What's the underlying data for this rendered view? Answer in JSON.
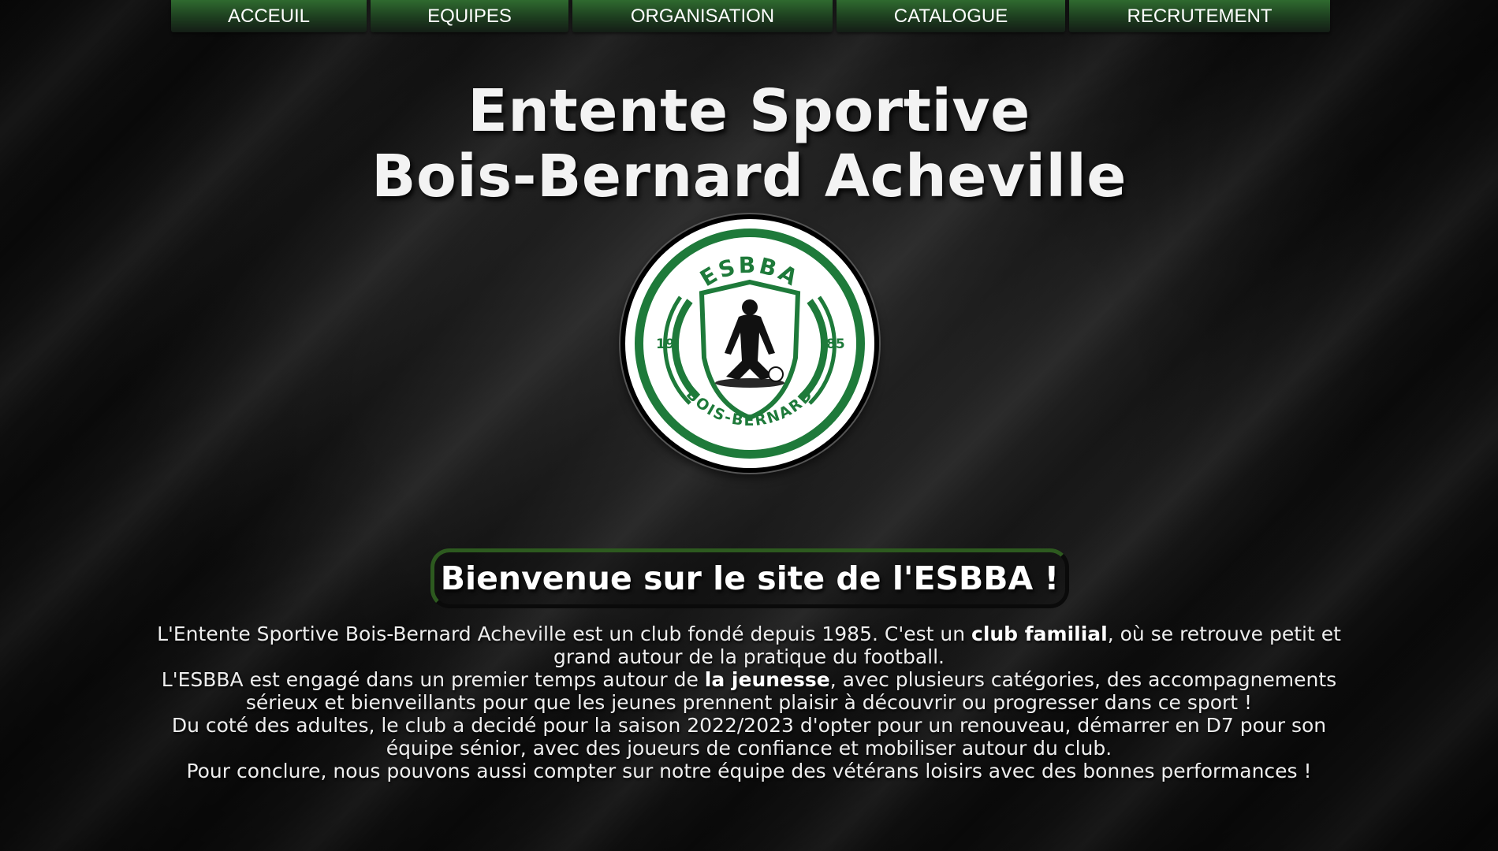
{
  "nav": {
    "items": [
      {
        "label": "ACCEUIL"
      },
      {
        "label": "EQUIPES"
      },
      {
        "label": "ORGANISATION"
      },
      {
        "label": "CATALOGUE"
      },
      {
        "label": "RECRUTEMENT"
      }
    ]
  },
  "hero": {
    "title_line1": "Entente Sportive",
    "title_line2": "Bois-Bernard Acheville"
  },
  "logo": {
    "top_text": "ESBBA",
    "bottom_text": "BOIS-BERNARD",
    "year_left": "19",
    "year_right": "85",
    "icon": "kneeling-player-silhouette-icon"
  },
  "welcome": {
    "heading": "Bienvenue sur le site de l'ESBBA !"
  },
  "description": {
    "p1_before": "L'Entente Sportive Bois-Bernard Acheville est un club fondé depuis 1985. C'est un ",
    "p1_strong": "club familial",
    "p1_after": ", où se retrouve petit et grand autour de la pratique du football.",
    "p2_before": "L'ESBBA est engagé dans un premier temps autour de ",
    "p2_strong": "la jeunesse",
    "p2_after": ", avec plusieurs catégories, des accompagnements sérieux et bienveillants pour que les jeunes prennent plaisir à découvrir ou progresser dans ce sport !",
    "p3": "Du coté des adultes, le club a decidé pour la saison 2022/2023 d'opter pour un renouveau, démarrer en D7 pour son équipe sénior, avec des joueurs de confiance et mobiliser autour du club.",
    "p4": "Pour conclure, nous pouvons aussi compter sur notre équipe des vétérans loisirs avec des bonnes performances !"
  },
  "colors": {
    "nav_green": "#2f6a2f",
    "logo_green": "#1e7a3a",
    "background": "#111111"
  }
}
